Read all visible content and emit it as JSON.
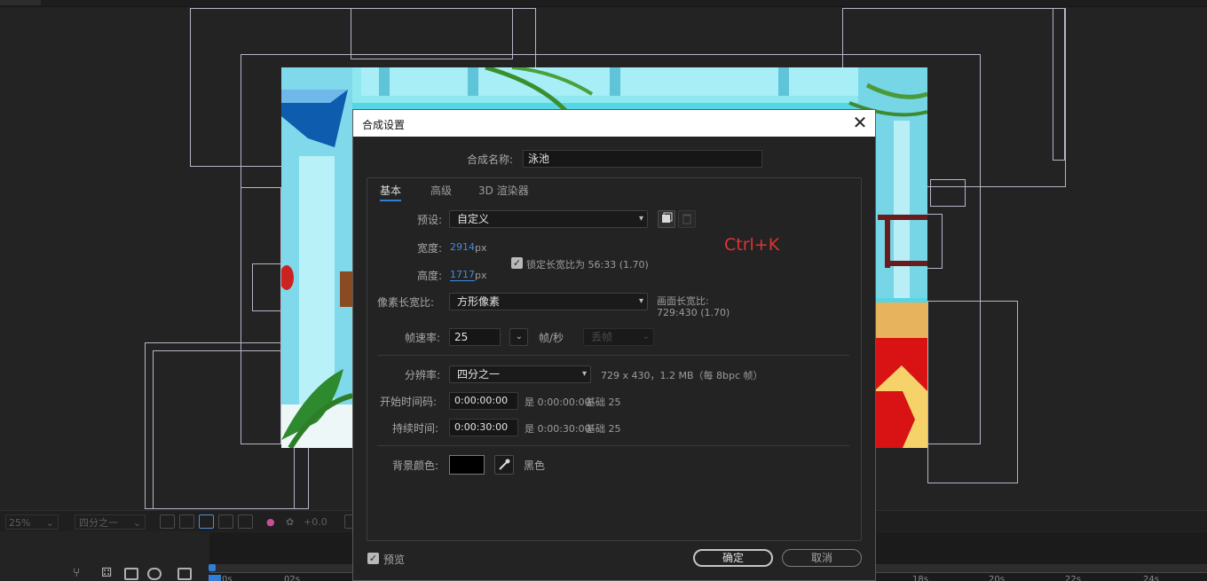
{
  "app": {
    "colors": {
      "accent": "#2f7fd8",
      "ctrl_hint": "#e03333",
      "bg": "#232323"
    }
  },
  "bottom_toolbar": {
    "zoom": "25%",
    "resolution": "四分之一",
    "exposure": "+0.0"
  },
  "timeline": {
    "ticks": [
      "0s",
      "02s",
      "18s",
      "20s",
      "22s",
      "24s"
    ]
  },
  "dialog": {
    "title": "合成设置",
    "close_icon": "close-icon",
    "comp_name_label": "合成名称:",
    "comp_name_value": "泳池",
    "tabs": [
      "基本",
      "高级",
      "3D 渲染器"
    ],
    "preset_label": "预设:",
    "preset_value": "自定义",
    "width_label": "宽度:",
    "width_value": "2914",
    "width_unit": "px",
    "height_label": "高度:",
    "height_value": "1717",
    "height_unit": "px",
    "lock_aspect_label": "锁定长宽比为 56:33 (1.70)",
    "lock_aspect_checked": true,
    "pixel_aspect_label": "像素长宽比:",
    "pixel_aspect_value": "方形像素",
    "frame_aspect_label": "画面长宽比:",
    "frame_aspect_value": "729:430 (1.70)",
    "frame_rate_label": "帧速率:",
    "frame_rate_value": "25",
    "frame_rate_unit": "帧/秒",
    "drop_frame_value": "丢帧",
    "resolution_label": "分辨率:",
    "resolution_value": "四分之一",
    "resolution_info": "729 x 430，1.2 MB（每 8bpc 帧）",
    "start_timecode_label": "开始时间码:",
    "start_timecode_value": "0:00:00:00",
    "start_timecode_is": "是 0:00:00:00",
    "start_timecode_base": "基础 25",
    "duration_label": "持续时间:",
    "duration_value": "0:00:30:00",
    "duration_is": "是 0:00:30:00",
    "duration_base": "基础 25",
    "bg_color_label": "背景颜色:",
    "bg_color_value": "#000000",
    "bg_color_name": "黑色",
    "preview_label": "预览",
    "preview_checked": true,
    "ok_label": "确定",
    "cancel_label": "取消",
    "shortcut_hint": "Ctrl+K"
  }
}
